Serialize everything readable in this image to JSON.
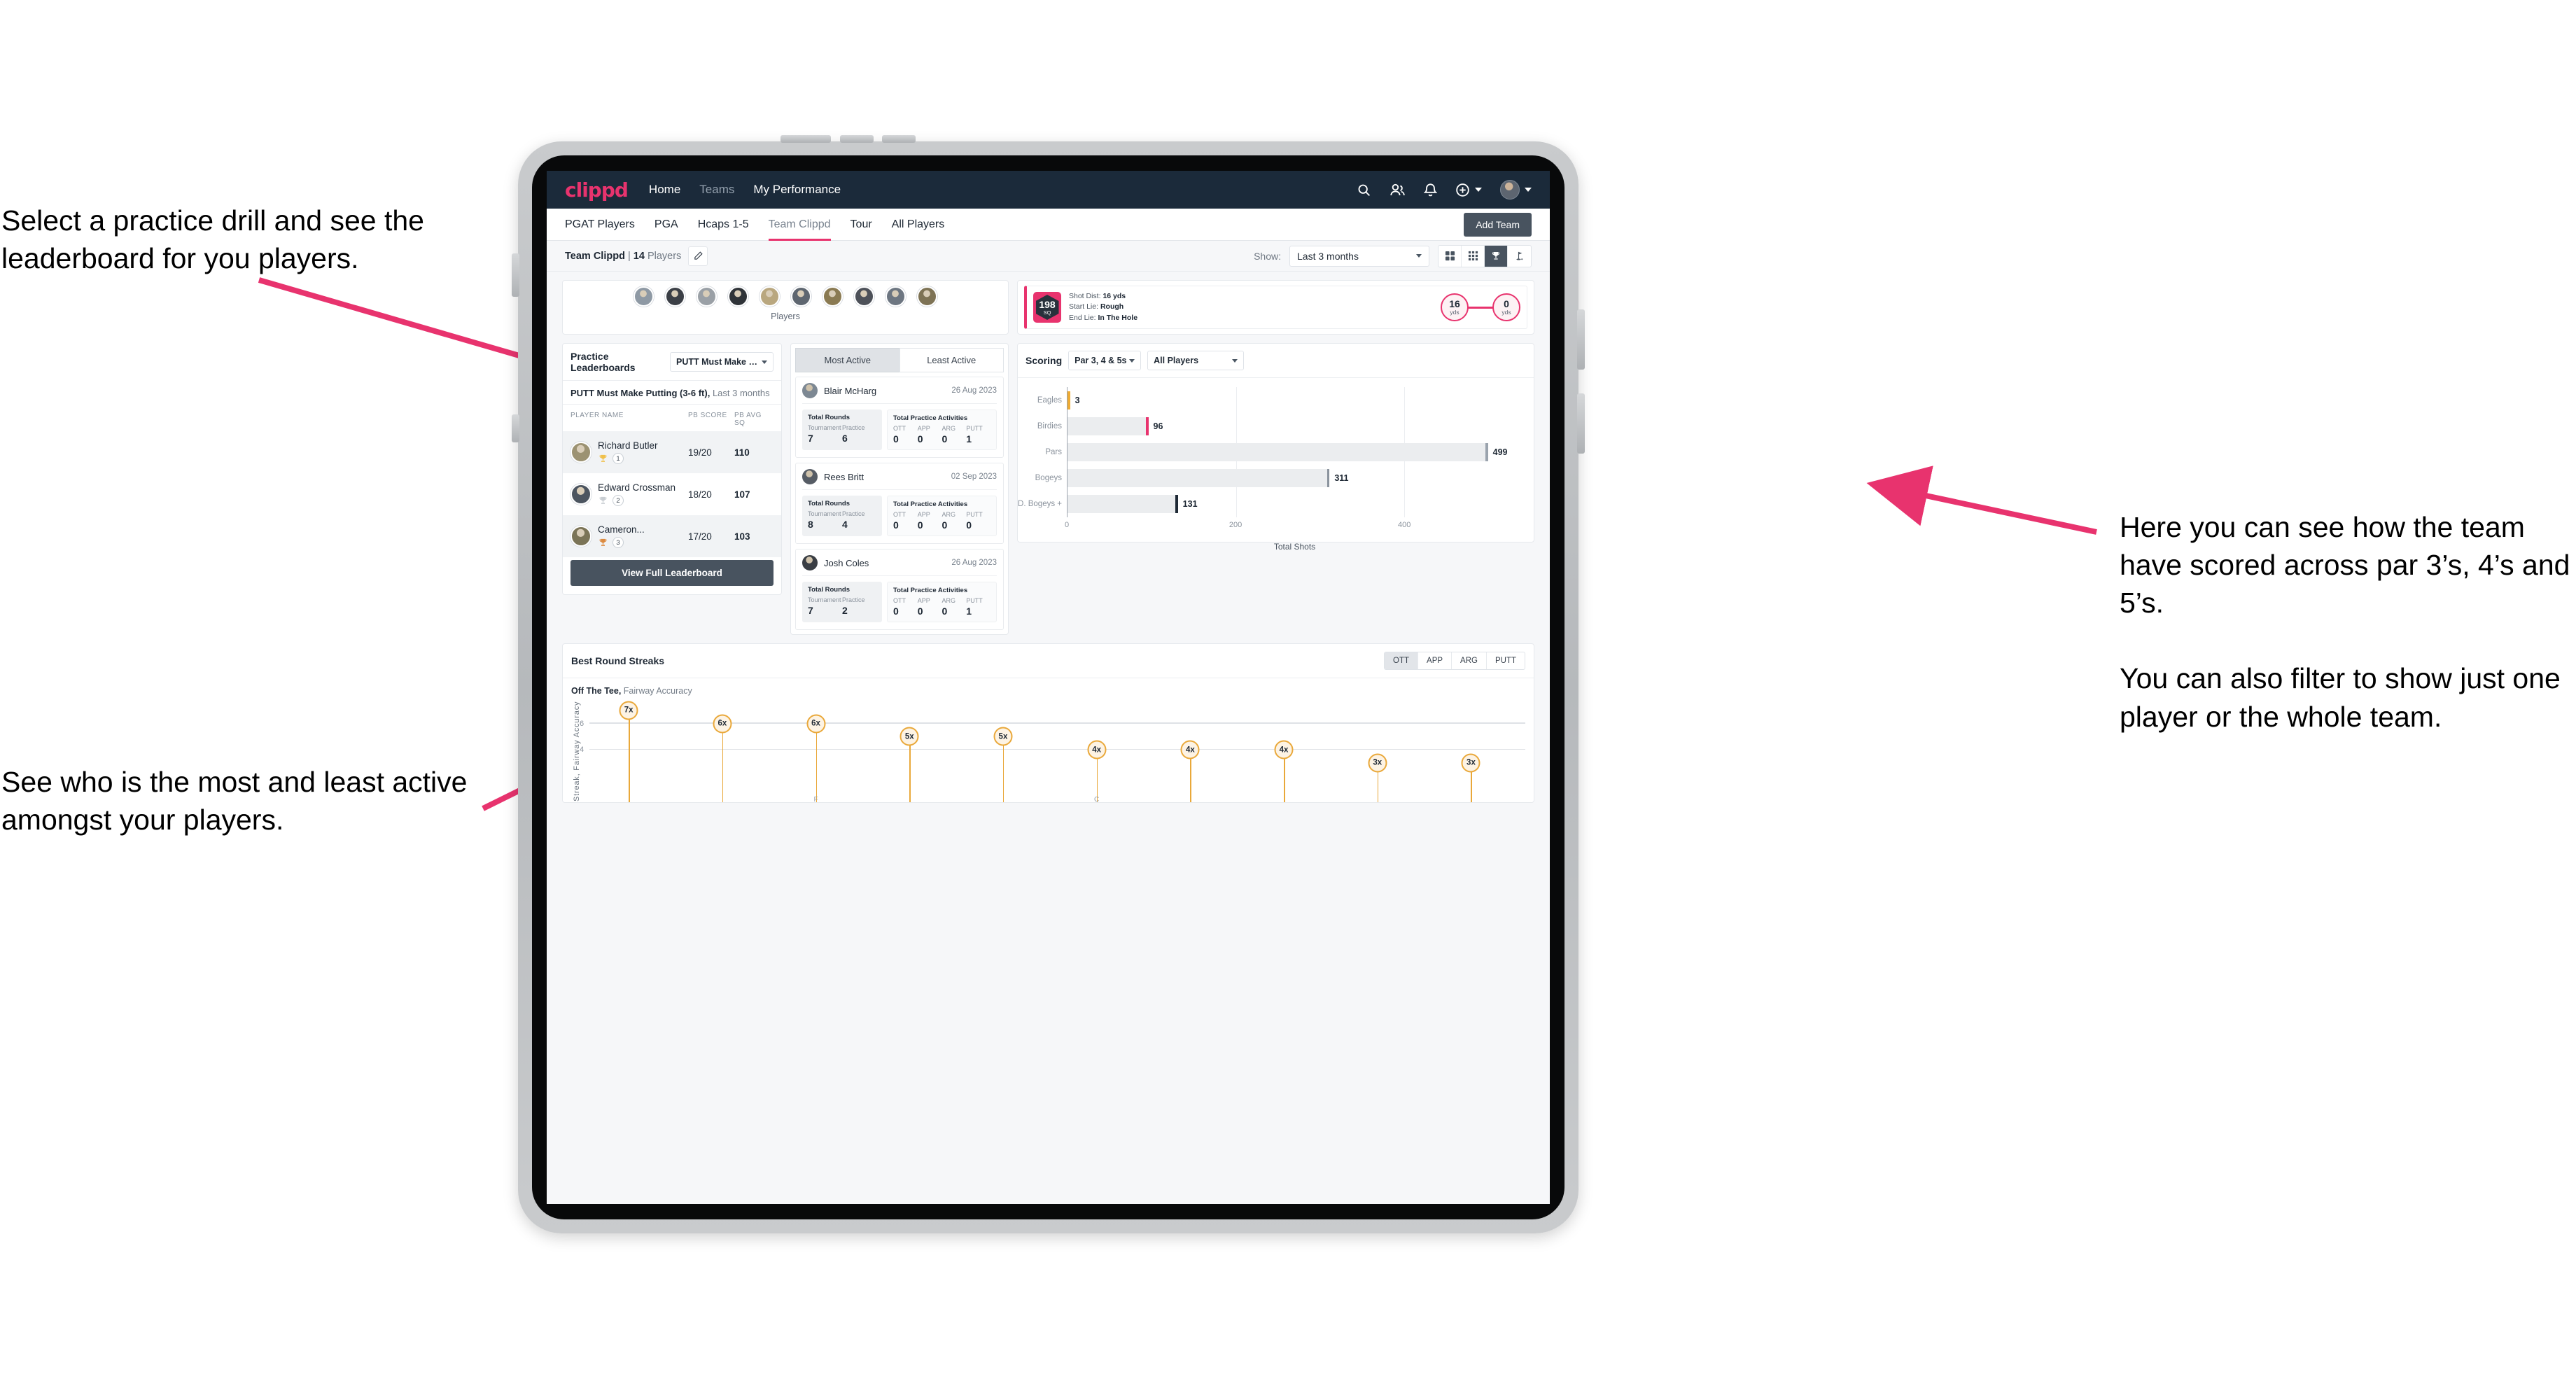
{
  "annotations": {
    "practice": "Select a practice drill and see the leaderboard for you players.",
    "activity": "See who is the most and least active amongst your players.",
    "scoring": "Here you can see how the team have scored across par 3’s, 4’s and 5’s.\n\nYou can also filter to show just one player or the whole team."
  },
  "app": {
    "brand": "clippd",
    "nav": [
      {
        "label": "Home",
        "active": true
      },
      {
        "label": "Teams",
        "active": false
      },
      {
        "label": "My Performance",
        "active": true
      }
    ],
    "icons": {
      "search": "search-icon",
      "people": "people-icon",
      "bell": "bell-icon",
      "plus": "plus-circle-icon",
      "avatar": "user-avatar"
    },
    "tabs": [
      {
        "label": "PGAT Players",
        "active": false
      },
      {
        "label": "PGA",
        "active": false
      },
      {
        "label": "Hcaps 1-5",
        "active": false
      },
      {
        "label": "Team Clippd",
        "active": true
      },
      {
        "label": "Tour",
        "active": false
      },
      {
        "label": "All Players",
        "active": false
      }
    ],
    "add_team_label": "Add Team"
  },
  "subbar": {
    "team_name": "Team Clippd",
    "separator": "|",
    "player_count": "14",
    "players_word": "Players",
    "edit_icon": "pencil-icon",
    "show_label": "Show:",
    "period_value": "Last 3 months",
    "view_toggles": [
      {
        "icon": "grid-4-icon",
        "active": false
      },
      {
        "icon": "grid-9-icon",
        "active": false
      },
      {
        "icon": "trophy-icon",
        "active": true
      },
      {
        "icon": "golf-flag-icon",
        "active": false
      }
    ]
  },
  "players_strip": {
    "caption": "Players",
    "count": 10,
    "avatar_colors": [
      "#8e99a4",
      "#3b3f46",
      "#9aa0a6",
      "#2f3338",
      "#b9a77f",
      "#5e6670",
      "#8a7a52",
      "#4d5159",
      "#6d7681",
      "#7e7355"
    ]
  },
  "shot_card": {
    "badge_number": "198",
    "badge_unit": "SQ",
    "lines": [
      {
        "label": "Shot Dist:",
        "value": "16 yds"
      },
      {
        "label": "Start Lie:",
        "value": "Rough"
      },
      {
        "label": "End Lie:",
        "value": "In The Hole"
      }
    ],
    "start_dist": {
      "value": "16",
      "unit": "yds"
    },
    "end_dist": {
      "value": "0",
      "unit": "yds"
    },
    "accent": "#e8336e"
  },
  "leaderboard": {
    "title": "Practice Leaderboards",
    "drill_select": "PUTT Must Make Putting ...",
    "subtitle_bold": "PUTT Must Make Putting (3-6 ft),",
    "subtitle_rest": " Last 3 months",
    "columns": [
      "PLAYER NAME",
      "PB SCORE",
      "PB AVG SQ"
    ],
    "rows": [
      {
        "name": "Richard Butler",
        "rank": "1",
        "trophy": "gold-trophy-icon",
        "trophy_color": "#f0c04a",
        "score": "19/20",
        "avg_sq": "110",
        "avatar": "#9c9272",
        "highlight": true
      },
      {
        "name": "Edward Crossman",
        "rank": "2",
        "trophy": "silver-trophy-icon",
        "trophy_color": "#c8cdd2",
        "score": "18/20",
        "avg_sq": "107",
        "avatar": "#4c5560",
        "highlight": false
      },
      {
        "name": "Cameron...",
        "rank": "3",
        "trophy": "bronze-trophy-icon",
        "trophy_color": "#dc8a3f",
        "score": "17/20",
        "avg_sq": "103",
        "avatar": "#7b7457",
        "highlight": true
      }
    ],
    "button_label": "View Full Leaderboard"
  },
  "activity": {
    "tabs": [
      {
        "label": "Most Active",
        "active": true
      },
      {
        "label": "Least Active",
        "active": false
      }
    ],
    "rounds_title": "Total Rounds",
    "rounds_labels": [
      "Tournament",
      "Practice"
    ],
    "acts_title": "Total Practice Activities",
    "acts_labels": [
      "OTT",
      "APP",
      "ARG",
      "PUTT"
    ],
    "items": [
      {
        "name": "Blair McHarg",
        "date": "26 Aug 2023",
        "avatar": "#7d8893",
        "rounds": [
          "7",
          "6"
        ],
        "acts": [
          "0",
          "0",
          "0",
          "1"
        ]
      },
      {
        "name": "Rees Britt",
        "date": "02 Sep 2023",
        "avatar": "#565c65",
        "rounds": [
          "8",
          "4"
        ],
        "acts": [
          "0",
          "0",
          "0",
          "0"
        ]
      },
      {
        "name": "Josh Coles",
        "date": "26 Aug 2023",
        "avatar": "#3a3e44",
        "rounds": [
          "7",
          "2"
        ],
        "acts": [
          "0",
          "0",
          "0",
          "1"
        ]
      }
    ]
  },
  "chart_data": [
    {
      "type": "bar",
      "orientation": "horizontal",
      "title": "Scoring",
      "filters": {
        "par_select": "Par 3, 4 & 5s",
        "player_select": "All Players"
      },
      "categories": [
        "Eagles",
        "Birdies",
        "Pars",
        "Bogeys",
        "D. Bogeys +"
      ],
      "values": [
        3,
        96,
        499,
        311,
        131
      ],
      "cap_colors": [
        "#eeab33",
        "#e8336e",
        "#9aa3ad",
        "#8a939d",
        "#1f2a36"
      ],
      "bar_color": "#ebedef",
      "xlabel": "Total Shots",
      "ylabel": "",
      "xlim": [
        0,
        540
      ],
      "xticks": [
        0,
        200,
        400
      ],
      "grid": true,
      "legend": "none"
    },
    {
      "type": "scatter",
      "title": "Best Round Streaks",
      "subtitle_bold": "Off The Tee,",
      "subtitle_rest": " Fairway Accuracy",
      "metric_tabs": [
        {
          "label": "OTT",
          "active": true
        },
        {
          "label": "APP",
          "active": false
        },
        {
          "label": "ARG",
          "active": false
        },
        {
          "label": "PUTT",
          "active": false
        }
      ],
      "ylabel": "Streak, Fairway Accuracy",
      "yticks": [
        4,
        6
      ],
      "ylim": [
        0,
        7.8
      ],
      "xcats": [
        "",
        "",
        "F",
        "",
        "",
        "C",
        "",
        "",
        "",
        ""
      ],
      "points": [
        {
          "label": "7x",
          "value": 7
        },
        {
          "label": "6x",
          "value": 6
        },
        {
          "label": "6x",
          "value": 6
        },
        {
          "label": "5x",
          "value": 5
        },
        {
          "label": "5x",
          "value": 5
        },
        {
          "label": "4x",
          "value": 4
        },
        {
          "label": "4x",
          "value": 4
        },
        {
          "label": "4x",
          "value": 4
        },
        {
          "label": "3x",
          "value": 3
        },
        {
          "label": "3x",
          "value": 3
        }
      ],
      "marker_fill": "#fdf3e4",
      "marker_stroke": "#e9a83a",
      "grid": true
    }
  ]
}
